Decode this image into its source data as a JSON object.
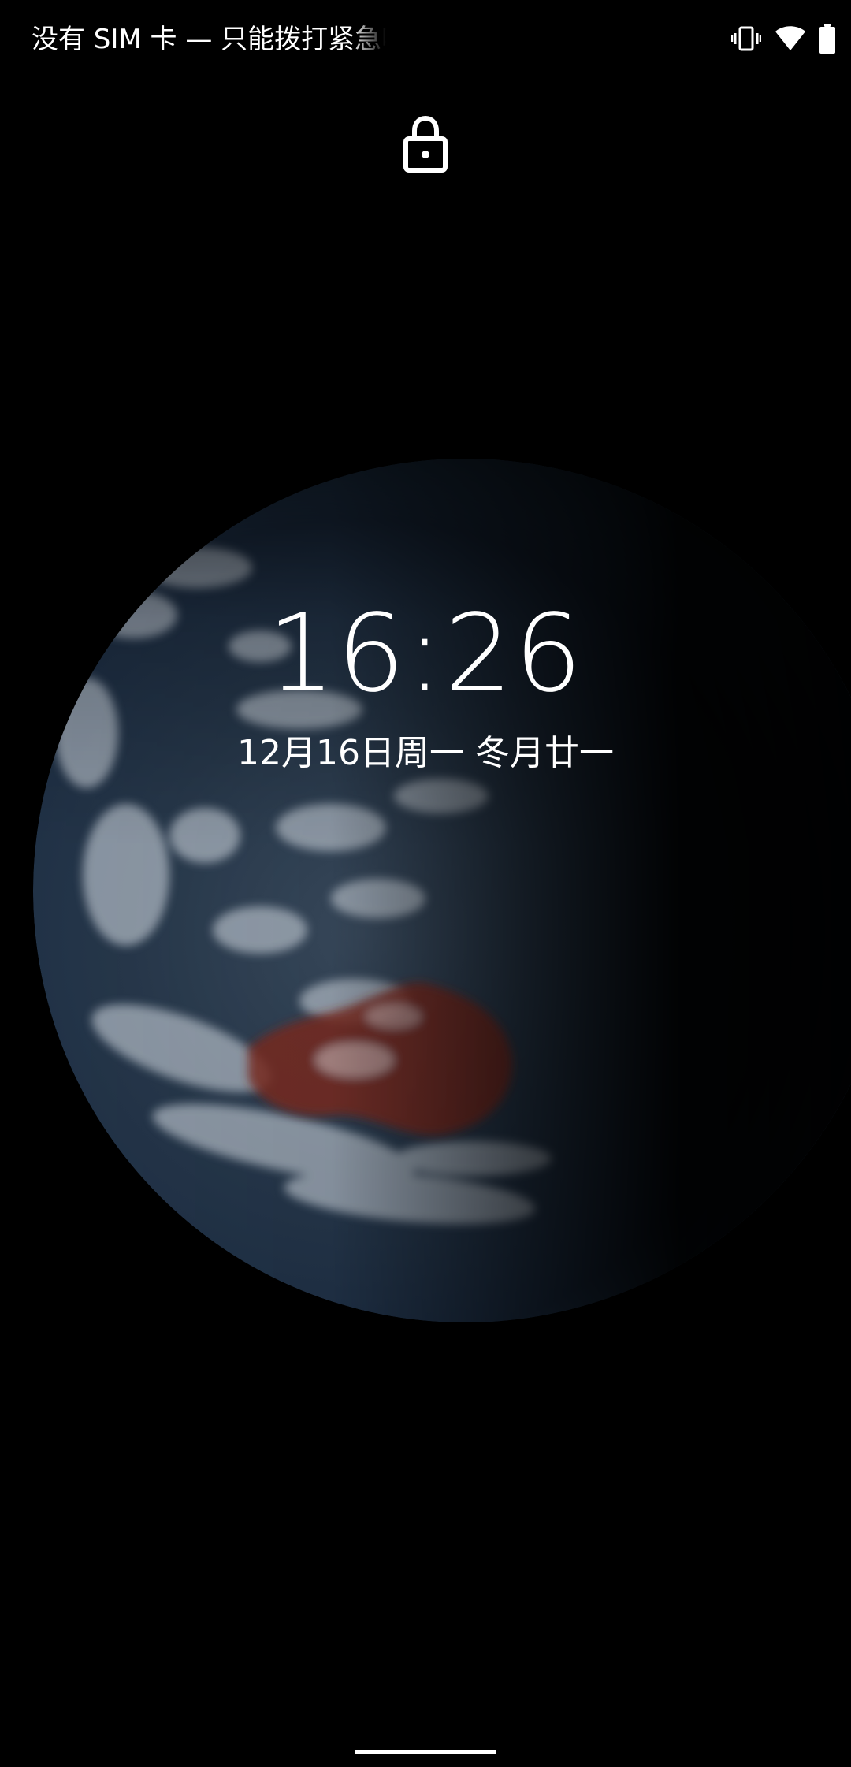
{
  "status_bar": {
    "carrier_text": "没有 SIM 卡 — 只能拨打紧急呼叫",
    "icons": [
      "vibrate-icon",
      "wifi-icon",
      "battery-icon"
    ]
  },
  "lockscreen": {
    "lock_icon": "lock-icon",
    "time": "16:26",
    "date": "12月16日周一 冬月廿一"
  },
  "wallpaper": {
    "subject": "earth"
  },
  "navigation": {
    "handle": "home-indicator"
  }
}
